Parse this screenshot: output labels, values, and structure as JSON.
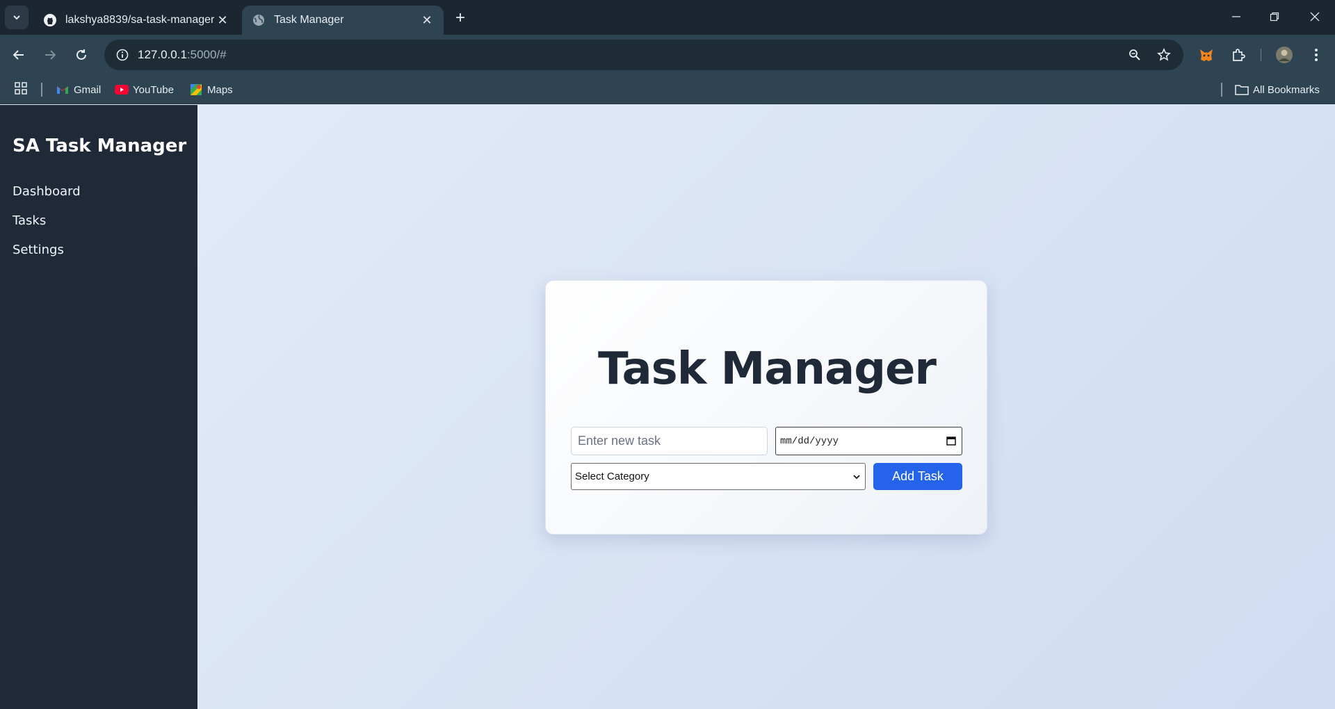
{
  "browser": {
    "tabs": [
      {
        "title": "lakshya8839/sa-task-manager",
        "icon": "github-icon",
        "active": false
      },
      {
        "title": "Task Manager",
        "icon": "globe-icon",
        "active": true
      }
    ],
    "url_host": "127.0.0.1",
    "url_rest": ":5000/#",
    "bookmarks": [
      {
        "label": "Gmail",
        "icon": "gmail-icon"
      },
      {
        "label": "YouTube",
        "icon": "youtube-icon"
      },
      {
        "label": "Maps",
        "icon": "maps-icon"
      }
    ],
    "all_bookmarks_label": "All Bookmarks"
  },
  "sidebar": {
    "title": "SA Task Manager",
    "items": [
      {
        "label": "Dashboard"
      },
      {
        "label": "Tasks"
      },
      {
        "label": "Settings"
      }
    ]
  },
  "card": {
    "heading": "Task Manager",
    "task_placeholder": "Enter new task",
    "date_placeholder": "mm/dd/yyyy",
    "category_selected": "Select Category",
    "add_button_label": "Add Task"
  },
  "colors": {
    "sidebar_bg": "#1f2937",
    "accent_button": "#2563eb",
    "heading_text": "#1f2937"
  }
}
